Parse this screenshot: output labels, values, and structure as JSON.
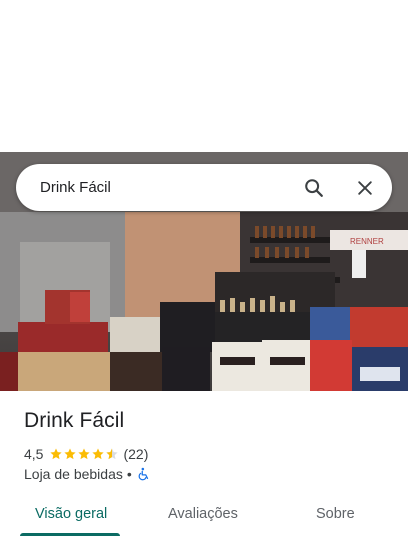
{
  "search": {
    "value": "Drink Fácil"
  },
  "place": {
    "name": "Drink Fácil",
    "rating": "4,5",
    "rating_value": 4.5,
    "reviews_count": "(22)",
    "category": "Loja de bebidas",
    "separator": "•"
  },
  "tabs": [
    {
      "label": "Visão geral",
      "active": true
    },
    {
      "label": "Avaliações",
      "active": false
    },
    {
      "label": "Sobre",
      "active": false
    }
  ],
  "colors": {
    "accent": "#0b6b63",
    "star": "#fbbc04",
    "accessibility": "#1a73e8"
  },
  "icons": [
    "search-icon",
    "close-icon",
    "star-icon",
    "wheelchair-icon"
  ]
}
